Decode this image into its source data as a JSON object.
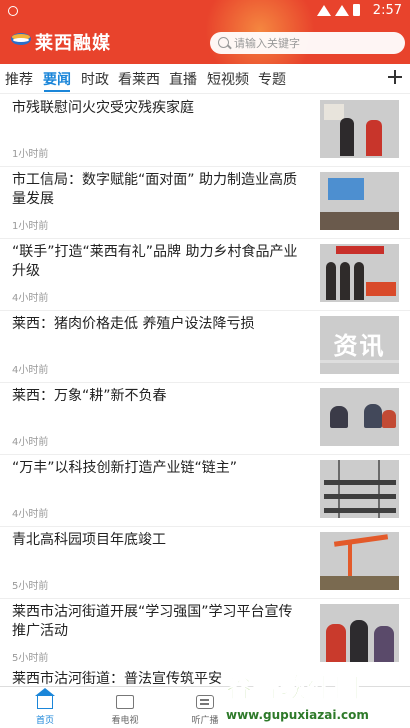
{
  "status_bar": {
    "time": "2:57"
  },
  "header": {
    "brand": "莱西融媒",
    "search_placeholder": "请输入关键字"
  },
  "tabs": [
    {
      "label": "推荐"
    },
    {
      "label": "要闻"
    },
    {
      "label": "时政"
    },
    {
      "label": "看莱西"
    },
    {
      "label": "直播"
    },
    {
      "label": "短视频"
    },
    {
      "label": "专题"
    }
  ],
  "active_tab": "要闻",
  "news": [
    {
      "title": "市残联慰问火灾受灾残疾家庭",
      "time": "1小时前",
      "thumb": "photo-visit"
    },
    {
      "title": "市工信局：数字赋能“面对面” 助力制造业高质量发展",
      "time": "1小时前",
      "thumb": "photo-meeting"
    },
    {
      "title": "“联手”打造“莱西有礼”品牌 助力乡村食品产业升级",
      "time": "4小时前",
      "thumb": "photo-exhibit"
    },
    {
      "title": "莱西：猪肉价格走低 养殖户设法降亏损",
      "time": "4小时前",
      "thumb": "资讯"
    },
    {
      "title": "莱西：万象“耕”新不负春",
      "time": "4小时前",
      "thumb": "photo-field"
    },
    {
      "title": "“万丰”以科技创新打造产业链“链主”",
      "time": "4小时前",
      "thumb": "photo-factory"
    },
    {
      "title": "青北高科园项目年底竣工",
      "time": "5小时前",
      "thumb": "photo-construction"
    },
    {
      "title": "莱西市沽河街道开展“学习强国”学习平台宣传推广活动",
      "time": "5小时前",
      "thumb": "photo-crowd"
    }
  ],
  "partial_item": {
    "title": "莱西市沽河街道：普法宣传筑平安"
  },
  "bottom_nav": [
    {
      "label": "首页"
    },
    {
      "label": "看电视"
    },
    {
      "label": "听广播"
    }
  ],
  "watermark": {
    "text": "谷普软件园",
    "url": "www.gupuxiazai.com"
  },
  "colors": {
    "header": "#e8432c",
    "accent": "#1b86d9"
  }
}
